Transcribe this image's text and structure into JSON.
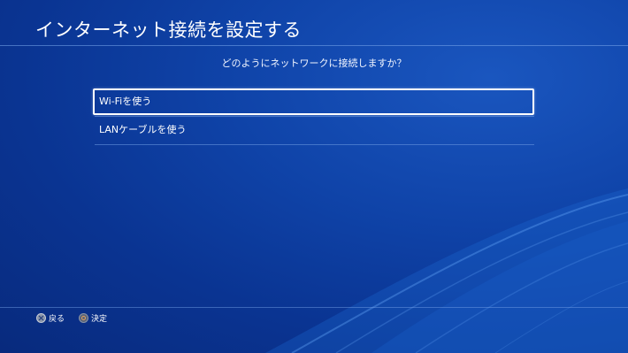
{
  "header": {
    "title": "インターネット接続を設定する"
  },
  "main": {
    "prompt": "どのようにネットワークに接続しますか？",
    "options": [
      {
        "label": "Wi-Fiを使う",
        "selected": true
      },
      {
        "label": "LANケーブルを使う",
        "selected": false
      }
    ]
  },
  "footer": {
    "back": {
      "icon": "cross-button-icon",
      "label": "戻る"
    },
    "confirm": {
      "icon": "circle-button-icon",
      "label": "決定"
    }
  },
  "colors": {
    "background": "#0c3a9a",
    "text": "#ffffff",
    "selection_border": "#ffffff"
  }
}
